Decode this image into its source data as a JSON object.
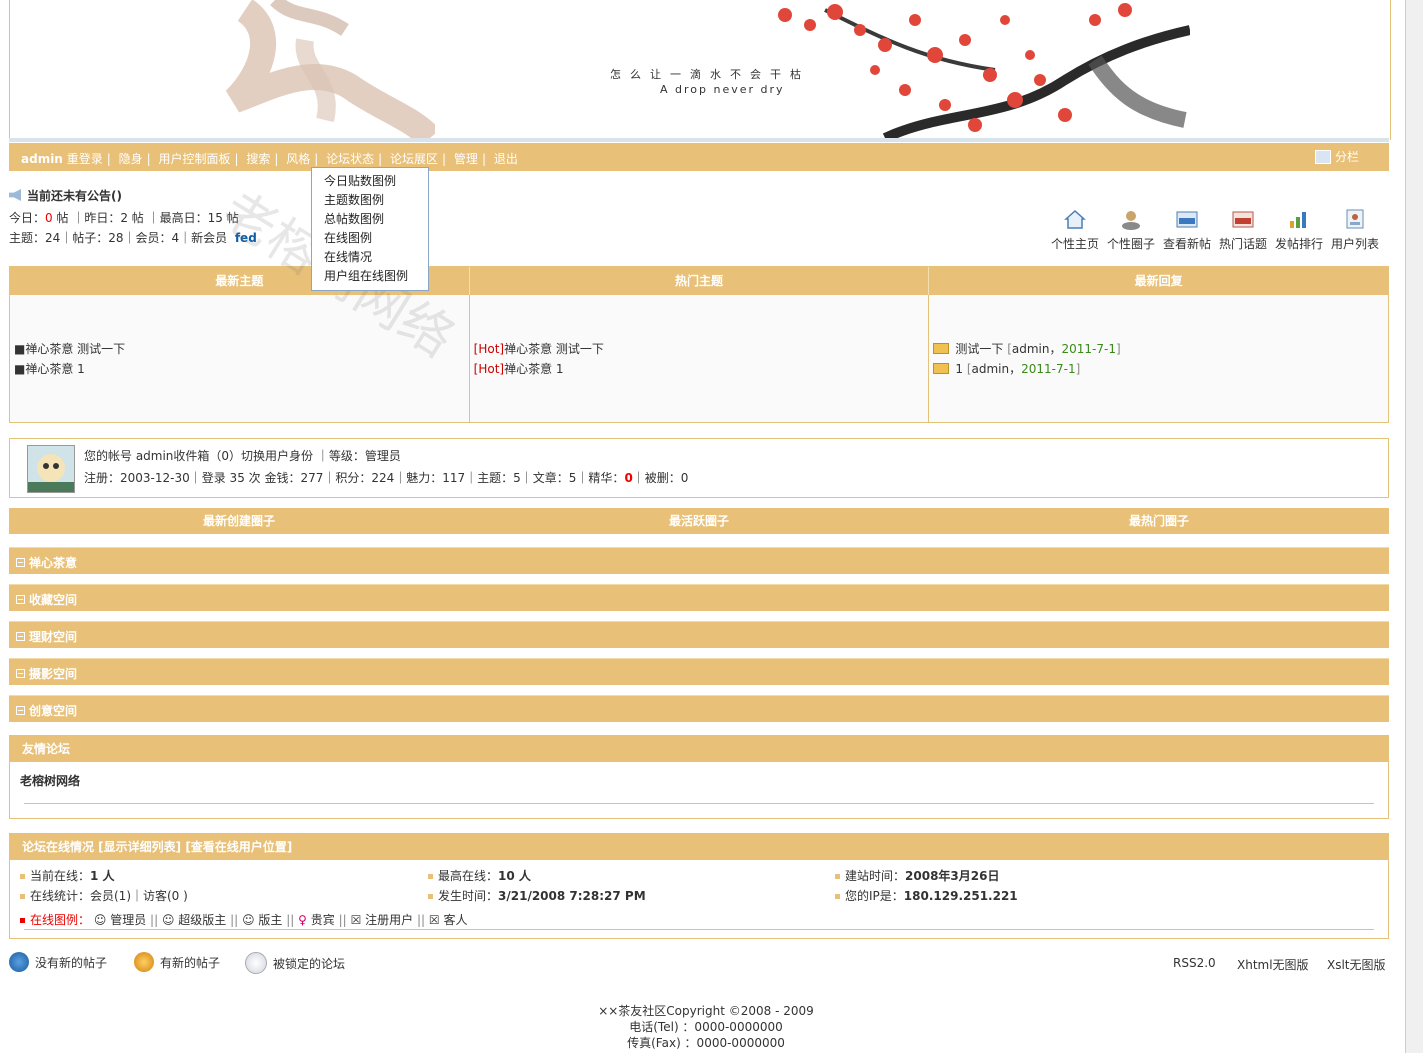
{
  "banner": {
    "slogan_cn": "怎么让一滴水不会干枯",
    "slogan_en": "A drop never dry"
  },
  "nav": {
    "user": "admin",
    "items": [
      "重登录",
      "隐身",
      "用户控制面板",
      "搜索",
      "风格",
      "论坛状态",
      "论坛展区",
      "管理",
      "退出"
    ],
    "split": "分栏"
  },
  "dropdown": [
    "今日贴数图例",
    "主题数图例",
    "总帖数图例",
    "在线图例",
    "在线情况",
    "用户组在线图例"
  ],
  "announce": {
    "title": "当前还未有公告()"
  },
  "stats": {
    "today_label": "今日：",
    "today": "0",
    "today_unit": "帖",
    "yesterday": "｜昨日：2 帖",
    "max": "｜最高日：15 帖",
    "line2": "主题：24｜帖子：28｜会员：4｜新会员",
    "newest": "fed"
  },
  "quick": [
    "个性主页",
    "个性圈子",
    "查看新帖",
    "热门话题",
    "发帖排行",
    "用户列表"
  ],
  "columns": {
    "headers": [
      "最新主题",
      "热门主题",
      "最新回复"
    ],
    "latest": [
      "■禅心茶意  测试一下",
      "■禅心茶意  1"
    ],
    "hot_tag": "[Hot]",
    "hot": [
      "禅心茶意  测试一下",
      "禅心茶意  1"
    ],
    "replies": [
      {
        "title": "测试一下",
        "user": "admin",
        "date": "2011-7-1"
      },
      {
        "title": "1",
        "user": "admin",
        "date": "2011-7-1"
      }
    ]
  },
  "account": {
    "line1": "您的帐号  admin收件箱（0）切换用户身份 ｜等级：管理员",
    "line2a": "注册：2003-12-30｜登录  35 次  金钱：277｜积分：224｜魅力：117｜主题：5｜文章：5｜精华：",
    "essence": "0",
    "line2b": "｜被删：0"
  },
  "groups": [
    "最新创建圈子",
    "最活跃圈子",
    "最热门圈子"
  ],
  "categories": [
    "禅心茶意",
    "收藏空间",
    "理财空间",
    "摄影空间",
    "创意空间"
  ],
  "friend": {
    "title": "友情论坛",
    "link": "老榕树网络"
  },
  "online": {
    "title": "论坛在线情况  [显示详细列表] [查看在线用户位置]",
    "current_label": "当前在线：",
    "current": "1 人",
    "peak_label": "最高在线：",
    "peak": "10 人",
    "founded_label": "建站时间：",
    "founded": "2008年3月26日",
    "stat_label": "在线统计：会员(1)｜访客(0 )",
    "time_label": "发生时间：",
    "time": "3/21/2008 7:28:27 PM",
    "ip_label": "您的IP是：",
    "ip": "180.129.251.221",
    "legend_label": "在线图例：",
    "legend": [
      "管理员",
      "超级版主",
      "版主",
      "贵宾",
      "注册用户",
      "客人"
    ]
  },
  "bottom_legend": [
    "没有新的帖子",
    "有新的帖子",
    "被锁定的论坛"
  ],
  "bottom_links": [
    "RSS2.0",
    "Xhtml无图版",
    "Xslt无图版"
  ],
  "footer": [
    "××茶友社区Copyright ©2008 - 2009",
    "电话(Tel) ：0000-0000000",
    "传真(Fax) ：0000-0000000"
  ],
  "watermark": "老榕树网络",
  "colors": {
    "header": "#e8c078",
    "border": "#e4c27a",
    "red": "#e00"
  }
}
